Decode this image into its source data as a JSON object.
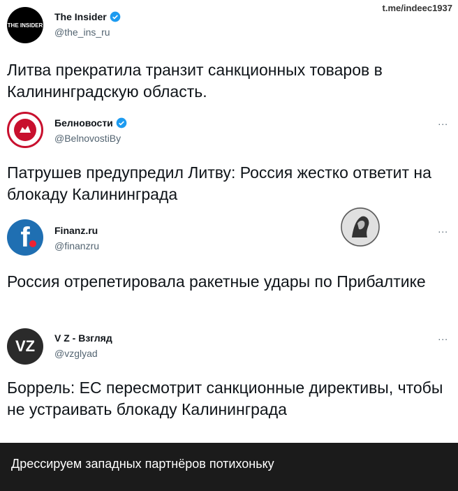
{
  "watermark": "t.me/indeec1937",
  "tweets": [
    {
      "name": "The Insider",
      "handle": "@the_ins_ru",
      "avatar_text": "THE INSIDER",
      "text": "Литва прекратила транзит санкционных товаров в Калининградскую область.",
      "verified": true
    },
    {
      "name": "Белновости",
      "handle": "@BelnovostiBy",
      "more": "...",
      "text": "Патрушев предупредил Литву: Россия жестко ответит на блокаду Калининграда",
      "verified": true
    },
    {
      "name": "Finanz.ru",
      "handle": "@finanzru",
      "more": "...",
      "avatar_text": "f",
      "text": "Россия отрепетировала ракетные удары по Прибалтике",
      "verified": false
    },
    {
      "name": "V Z - Взгляд",
      "handle": "@vzglyad",
      "more": "...",
      "avatar_text": "VZ",
      "text": "Боррель: ЕС пересмотрит санкционные директивы, чтобы не устраивать блокаду Калининграда",
      "verified": false
    }
  ],
  "caption": "Дрессируем западных партнёров потихоньку",
  "colors": {
    "verified_blue": "#1d9bf0",
    "belnovosti_red": "#c8102e",
    "finanz_blue": "#1f6fb2",
    "caption_bg": "#1b1b1b"
  }
}
